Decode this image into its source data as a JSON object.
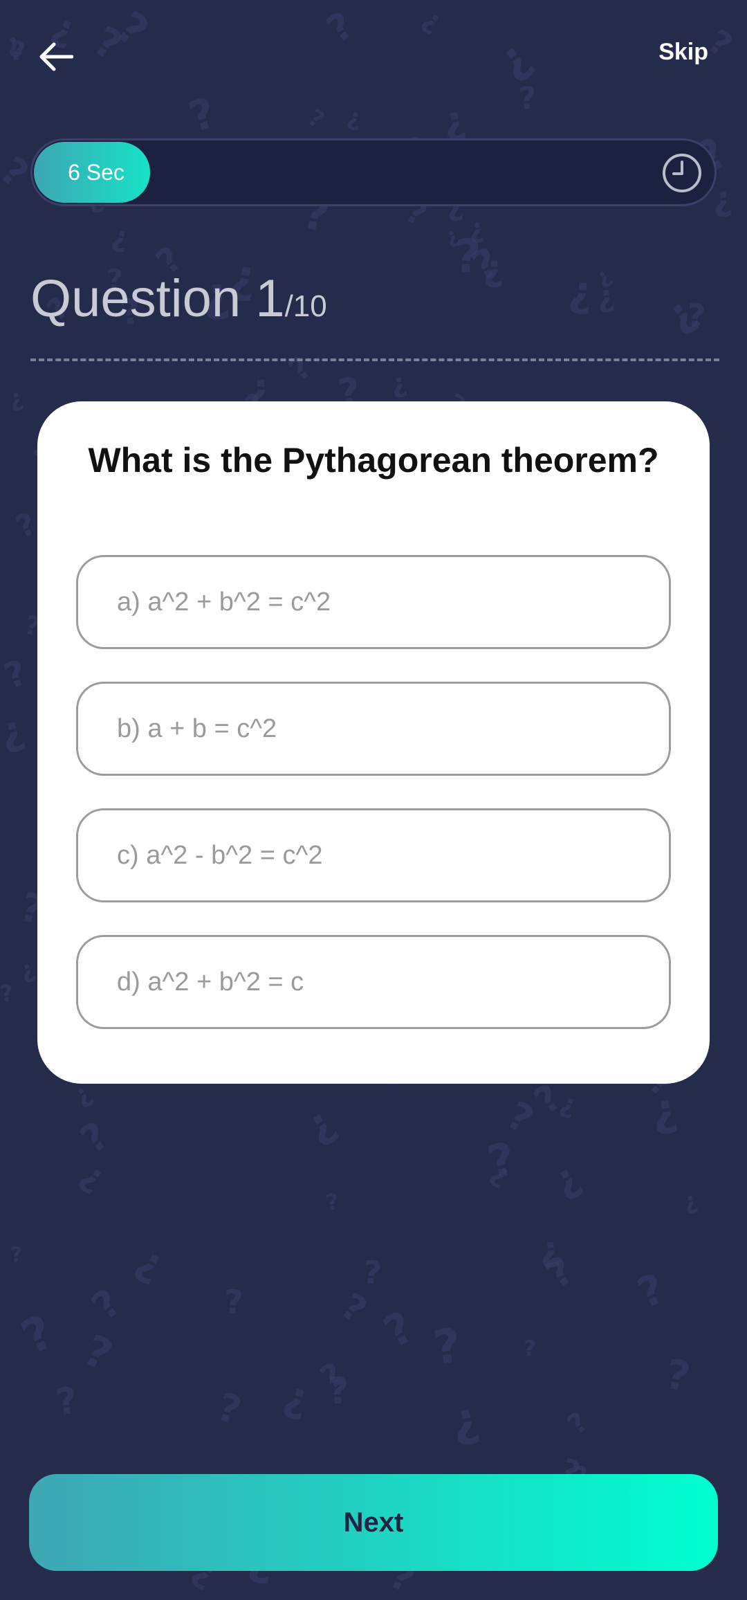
{
  "header": {
    "back_icon": "arrow-left-icon",
    "skip_label": "Skip"
  },
  "timer": {
    "label": "6 Sec",
    "icon": "clock-icon",
    "progress": 0.17
  },
  "question_heading": {
    "current": "Question 1",
    "total": "/10"
  },
  "card": {
    "question": "What is the Pythagorean theorem?",
    "options": [
      {
        "label": "a) a^2 + b^2 = c^2"
      },
      {
        "label": "b) a + b = c^2"
      },
      {
        "label": "c) a^2 - b^2 = c^2"
      },
      {
        "label": "d) a^2 + b^2 = c"
      }
    ]
  },
  "footer": {
    "next_label": "Next"
  },
  "colors": {
    "background": "#252b4a",
    "accent_start": "#3fa6b4",
    "accent_end": "#00ffd0",
    "card": "#ffffff",
    "option_border": "#9c9c9c",
    "option_text": "#9a9a9a"
  }
}
